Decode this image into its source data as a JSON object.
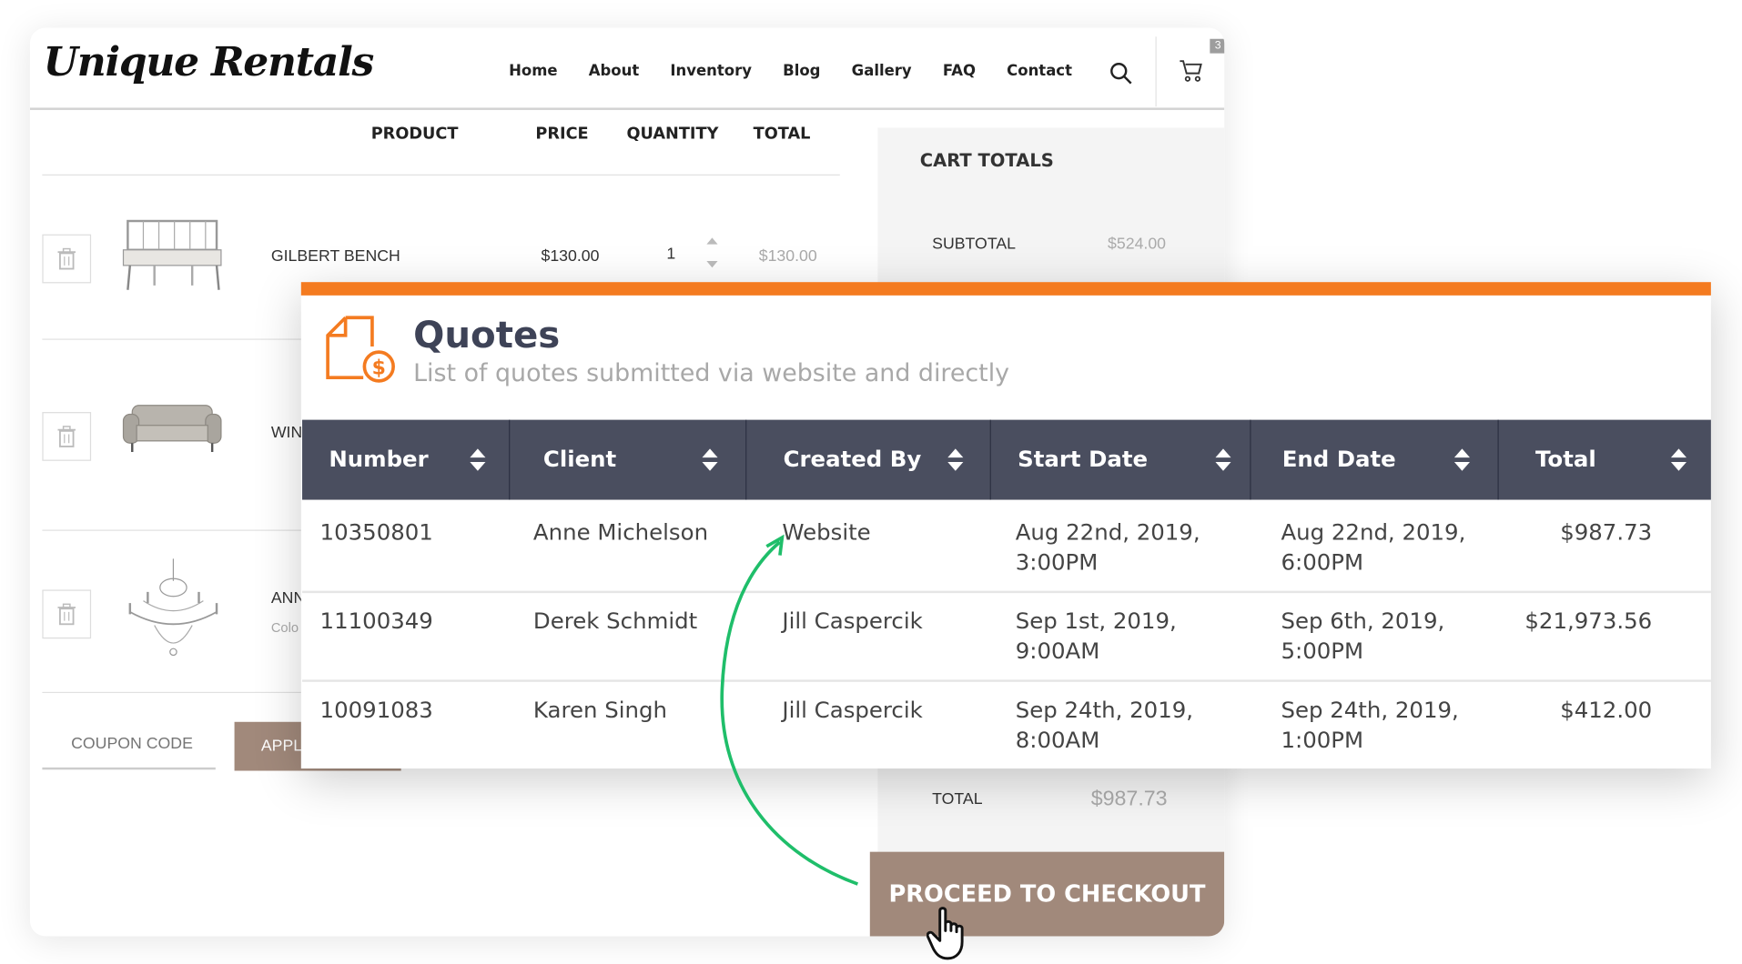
{
  "shop": {
    "logo": "Unique Rentals",
    "nav": [
      "Home",
      "About",
      "Inventory",
      "Blog",
      "Gallery",
      "FAQ",
      "Contact"
    ],
    "cart_count": "3",
    "columns": {
      "product": "PRODUCT",
      "price": "PRICE",
      "quantity": "QUANTITY",
      "total": "TOTAL"
    },
    "items": [
      {
        "name": "GILBERT BENCH",
        "sub": "",
        "price": "$130.00",
        "qty": "1",
        "total": "$130.00",
        "thumb": "bench-image"
      },
      {
        "name": "WIN",
        "sub": "",
        "thumb": "sofa-image"
      },
      {
        "name": "ANN",
        "sub": "Colo",
        "thumb": "chandelier-image"
      }
    ],
    "coupon_placeholder": "COUPON CODE",
    "apply_label": "APPLY",
    "totals": {
      "title": "CART TOTALS",
      "subtotal_label": "SUBTOTAL",
      "subtotal_value": "$524.00",
      "total_label": "TOTAL",
      "total_value": "$987.73"
    },
    "checkout_label": "PROCEED TO CHECKOUT"
  },
  "quotes": {
    "title": "Quotes",
    "subtitle": "List of quotes submitted via website and directly",
    "columns": [
      "Number",
      "Client",
      "Created By",
      "Start Date",
      "End Date",
      "Total"
    ],
    "rows": [
      {
        "number": "10350801",
        "client": "Anne Michelson",
        "created_by": "Website",
        "start_1": "Aug 22nd, 2019,",
        "start_2": "3:00PM",
        "end_1": "Aug 22nd, 2019,",
        "end_2": "6:00PM",
        "total": "$987.73"
      },
      {
        "number": "11100349",
        "client": "Derek Schmidt",
        "created_by": "Jill Caspercik",
        "start_1": "Sep 1st, 2019,",
        "start_2": "9:00AM",
        "end_1": "Sep 6th, 2019,",
        "end_2": "5:00PM",
        "total": "$21,973.56"
      },
      {
        "number": "10091083",
        "client": "Karen Singh",
        "created_by": "Jill Caspercik",
        "start_1": "Sep 24th, 2019,",
        "start_2": "8:00AM",
        "end_1": "Sep 24th, 2019,",
        "end_2": "1:00PM",
        "total": "$412.00"
      }
    ]
  },
  "colors": {
    "accent_orange": "#f47b20",
    "table_header": "#4a4e5f",
    "checkout_brown": "#a1897b",
    "arrow_green": "#1fbe6a"
  }
}
